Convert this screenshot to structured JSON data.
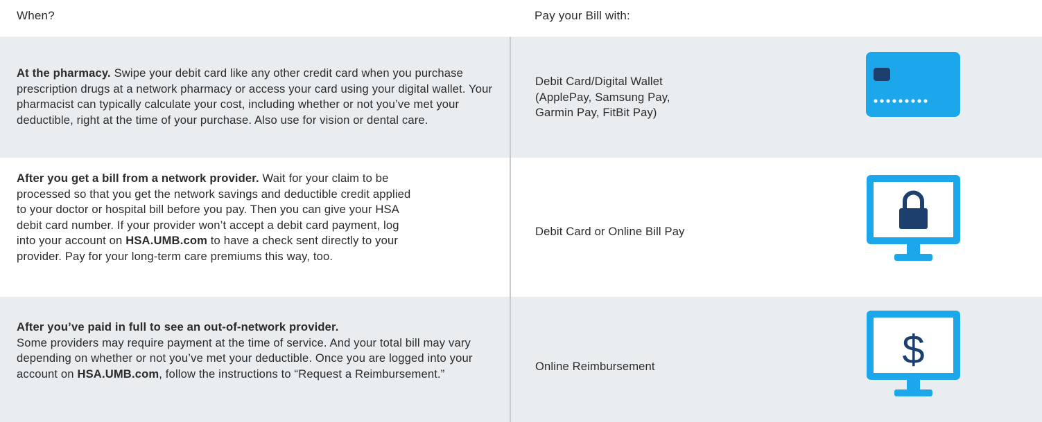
{
  "header": {
    "when_label": "When?",
    "pay_label": "Pay your Bill with:"
  },
  "rows": [
    {
      "when_bold": "At the pharmacy.",
      "when_text": " Swipe your debit card like any other credit card when you purchase prescription drugs at a network pharmacy or access your card using your digital wallet. Your pharmacist can typically calculate your cost, including whether or not you’ve met your deductible, right at the time of your purchase. Also use for vision or dental care.",
      "pay_lines": [
        "Debit Card/Digital Wallet",
        "(ApplePay, Samsung Pay,",
        "Garmin Pay, FitBit Pay)"
      ],
      "icon": "debit-card-icon",
      "shaded": true
    },
    {
      "when_bold": "After you get a bill from a network provider.",
      "when_text_1": " Wait for your claim to be processed so that you get the network savings and deductible credit applied to your doctor or hospital bill before you pay. Then you can give your HSA debit card number. If your provider won’t accept a debit card payment, log into your account on ",
      "when_link": "HSA.UMB.com",
      "when_text_2": " to have a check sent directly to your provider. Pay for your long-term care premiums this way, too.",
      "pay_label": "Debit Card or Online Bill Pay",
      "icon": "monitor-lock-icon",
      "shaded": false
    },
    {
      "when_bold": "After you’ve paid in full to see an out-of-network provider.",
      "when_text_1": "Some providers may require payment at the time of service. And your total bill may vary depending on whether or not you’ve met your deductible. Once you are logged into your account on ",
      "when_link": "HSA.UMB.com",
      "when_text_2": ", follow the instructions to “Request a Reimbursement.”",
      "pay_label": "Online Reimbursement",
      "icon": "monitor-dollar-icon",
      "shaded": true
    }
  ],
  "colors": {
    "icon_blue": "#1ba7e9",
    "icon_dark": "#1c3f6e",
    "row_shade": "#e9edf0",
    "divider": "#c6cbcf"
  }
}
